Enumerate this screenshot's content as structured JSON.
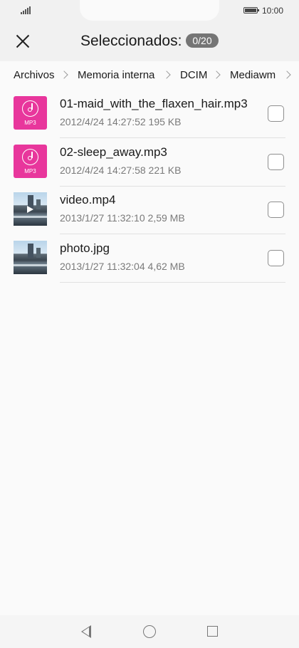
{
  "status_bar": {
    "time": "10:00"
  },
  "header": {
    "title": "Seleccionados:",
    "selection_count": "0/20"
  },
  "breadcrumb": [
    "Archivos",
    "Memoria interna",
    "DCIM",
    "Mediawm"
  ],
  "files": [
    {
      "name": "01-maid_with_the_flaxen_hair.mp3",
      "meta": "2012/4/24 14:27:52 195 KB",
      "type": "audio",
      "badge": "MP3",
      "checked": false
    },
    {
      "name": "02-sleep_away.mp3",
      "meta": "2012/4/24 14:27:58 221 KB",
      "type": "audio",
      "badge": "MP3",
      "checked": false
    },
    {
      "name": "video.mp4",
      "meta": "2013/1/27 11:32:10 2,59 MB",
      "type": "video",
      "checked": false
    },
    {
      "name": "photo.jpg",
      "meta": "2013/1/27 11:32:04 4,62 MB",
      "type": "image",
      "checked": false
    }
  ],
  "icons": {
    "close": "close-icon",
    "breadcrumb_separator": "chevron-right-icon",
    "nav_back": "triangle-back-icon",
    "nav_home": "circle-home-icon",
    "nav_recent": "square-recents-icon"
  },
  "colors": {
    "audio_thumb": "#e8369c",
    "badge_bg": "#757575"
  }
}
